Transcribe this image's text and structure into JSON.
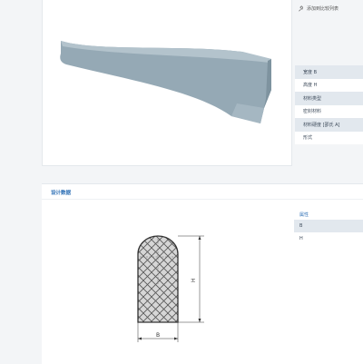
{
  "product": {
    "image_alt": "seal profile strip",
    "colors": {
      "profile": "#95a9b5",
      "profile_shadow": "#7e939f",
      "profile_highlight": "#b3c3cc"
    }
  },
  "sidebar": {
    "add_to_compare_label": "添加到比较列表",
    "properties": [
      {
        "label": "宽度 B"
      },
      {
        "label": "高度 H"
      },
      {
        "label": "材料类型"
      },
      {
        "label": "密封材料"
      },
      {
        "label": "材料硬度 [邵氏 A]"
      },
      {
        "label": "形式"
      }
    ]
  },
  "design_data": {
    "title": "设计数据",
    "attributes_header": "属性",
    "rows": [
      {
        "label": "B"
      },
      {
        "label": "H"
      }
    ],
    "drawing": {
      "height_label": "H",
      "width_label": "B"
    }
  }
}
